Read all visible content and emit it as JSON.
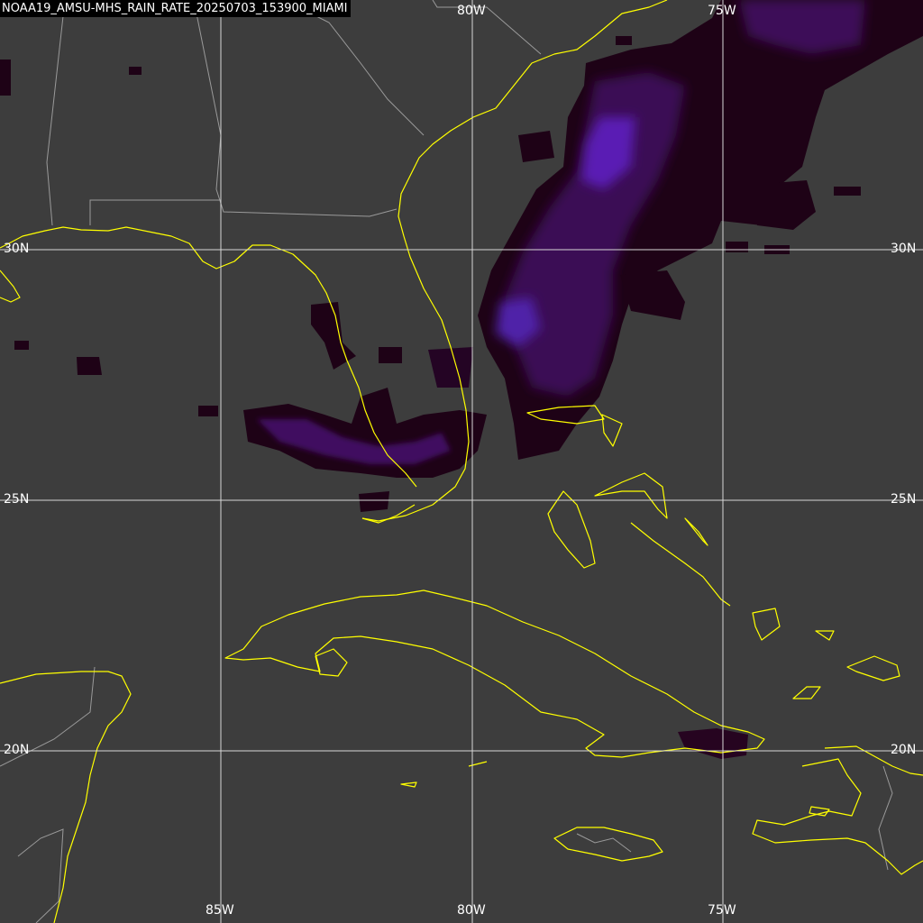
{
  "title": "NOAA19_AMSU-MHS_RAIN_RATE_20250703_153900_MIAMI",
  "grid": {
    "longitudes": [
      {
        "label": "85W",
        "value": -85
      },
      {
        "label": "80W",
        "value": -80
      },
      {
        "label": "75W",
        "value": -75
      }
    ],
    "latitudes": [
      {
        "label": "30N",
        "value": 30
      },
      {
        "label": "25N",
        "value": 25
      },
      {
        "label": "20N",
        "value": 20
      }
    ]
  },
  "colors": {
    "background": "#3d3d3d",
    "grid": "#d8d8d8",
    "coastline": "#ffff00",
    "borders": "#9a9a9a",
    "rain_dark": "#200018",
    "rain_mid": "#3c0a55",
    "rain_bright": "#5a20b8"
  },
  "layers": [
    "rain-rate-overlay",
    "coastlines",
    "state-borders",
    "lat-lon-grid"
  ]
}
